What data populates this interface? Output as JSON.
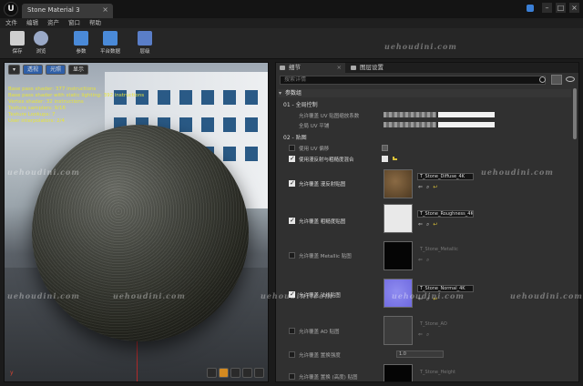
{
  "titlebar": {
    "tab_title": "Stone Material 3",
    "tab_close": "×",
    "logo": "U",
    "minimize": "–",
    "maximize": "□",
    "close": "×"
  },
  "menu": [
    "文件",
    "编辑",
    "资产",
    "窗口",
    "帮助"
  ],
  "toolbar": {
    "buttons": [
      {
        "label": "保存",
        "icon": "save-icon",
        "color": "#cfcfcf"
      },
      {
        "label": "浏览",
        "icon": "browse-icon",
        "color": "#9aa9c7"
      },
      {
        "label": "参数",
        "icon": "params-icon",
        "color": "#4a8ad8"
      },
      {
        "label": "平台数据",
        "icon": "platform-stats-icon",
        "color": "#4a8ad8"
      },
      {
        "label": "层级",
        "icon": "hierarchy-icon",
        "color": "#5a7ec8"
      }
    ]
  },
  "viewport": {
    "controls": [
      "▾",
      "透视",
      "光照",
      "显示"
    ],
    "stats": [
      "Base pass shader: 377 instructions",
      "Base pass shader with static lighting: 392 instructions",
      "Vertex shader: 32 instructions",
      "Texture samplers: 9/16",
      "Texture Lookups: 7",
      "User interpolators: 2/4"
    ],
    "axis_label": "y"
  },
  "details": {
    "tabs": [
      {
        "label": "细节"
      },
      {
        "label": "图层设置"
      }
    ],
    "search_placeholder": "搜索详情",
    "category_main": "参数组",
    "subgroup_global": "01 - 全局控制",
    "subgroup_texture": "02 - 贴图",
    "rows": {
      "r1": "允许覆盖 UV 贴图缩放系数",
      "r2": "全局 UV 平铺",
      "r3": "使用 UV 偏移",
      "r4": "使用漫反射与粗糙度混合",
      "r5": "允许覆盖 漫反射贴图",
      "r6": "允许覆盖 粗糙度贴图",
      "r7": "允许覆盖 Metallic 贴图",
      "r8": "允许覆盖 法线贴图",
      "r9": "允许覆盖 AO 贴图",
      "r10": "允许覆盖 置换强度",
      "r11": "允许覆盖 置换 (高度) 贴图"
    },
    "textures": {
      "diffuse": "T_Stone_Diffuse_4K",
      "rough": "T_Stone_Roughness_4K",
      "metal": "T_Stone_Metallic",
      "normal": "T_Stone_Normal_4K",
      "ao": "T_Stone_AO",
      "height": "T_Stone_Height"
    },
    "disp_value": "1.0"
  },
  "watermark": "uehoudini.com"
}
